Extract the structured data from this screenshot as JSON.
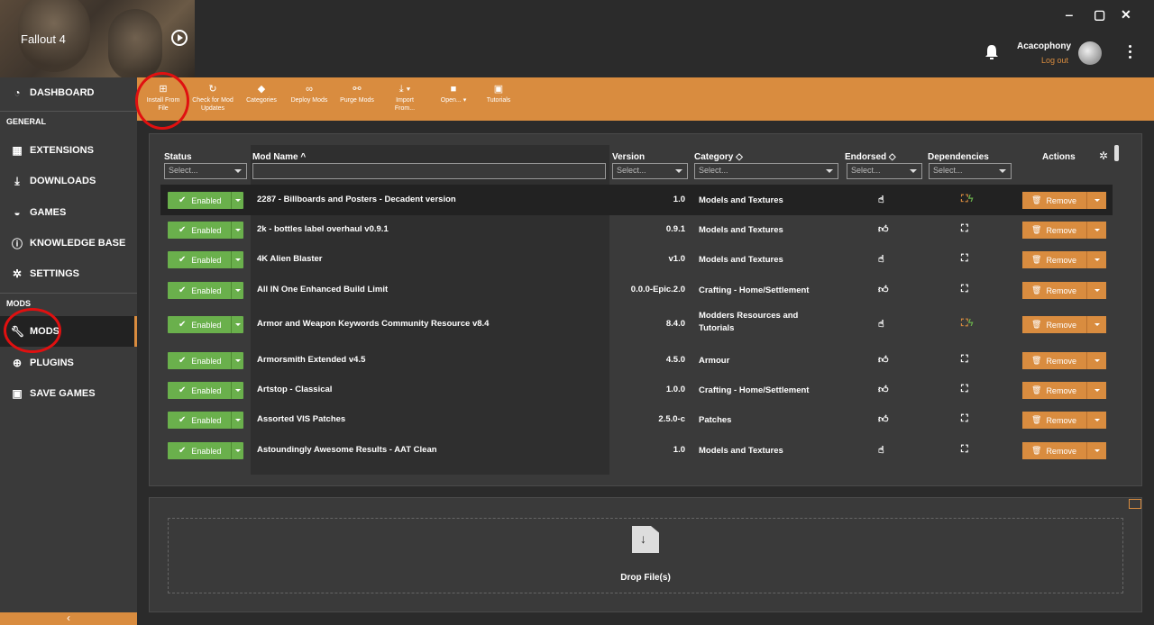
{
  "game": {
    "title": "Fallout 4"
  },
  "window": {
    "minimize": "‒",
    "maximize": "▢",
    "close": "✕"
  },
  "user": {
    "name": "Acacophony",
    "logout": "Log out"
  },
  "sidebar": {
    "dashboard": "DASHBOARD",
    "section_general": "GENERAL",
    "extensions": "EXTENSIONS",
    "downloads": "DOWNLOADS",
    "games": "GAMES",
    "knowledge_base": "KNOWLEDGE BASE",
    "settings": "SETTINGS",
    "section_mods": "MODS",
    "mods": "MODS",
    "plugins": "PLUGINS",
    "save_games": "SAVE GAMES"
  },
  "toolbar": {
    "install": "Install From File",
    "check": "Check for Mod Updates",
    "categories": "Categories",
    "deploy": "Deploy Mods",
    "purge": "Purge Mods",
    "import": "Import From...",
    "open": "Open...",
    "tutorials": "Tutorials"
  },
  "table": {
    "headers": {
      "status": "Status",
      "name": "Mod Name ^",
      "version": "Version",
      "category": "Category ◇",
      "endorsed": "Endorsed ◇",
      "dependencies": "Dependencies",
      "actions": "Actions"
    },
    "filter_placeholder": "Select...",
    "status_label": "Enabled",
    "remove_label": "Remove",
    "rows": [
      {
        "name": "2287 - Billboards and Posters - Decadent version",
        "version": "1.0",
        "category": "Models and Textures",
        "endorsed": false,
        "dep_active": true
      },
      {
        "name": "2k - bottles label overhaul v0.9.1",
        "version": "0.9.1",
        "category": "Models and Textures",
        "endorsed": true,
        "dep_active": false
      },
      {
        "name": "4K Alien Blaster",
        "version": "v1.0",
        "category": "Models and Textures",
        "endorsed": false,
        "dep_active": false
      },
      {
        "name": "All IN One Enhanced Build Limit",
        "version": "0.0.0-Epic.2.0",
        "category": "Crafting - Home/Settlement",
        "endorsed": true,
        "dep_active": false
      },
      {
        "name": "Armor and Weapon Keywords Community Resource v8.4",
        "version": "8.4.0",
        "category": "Modders Resources and Tutorials",
        "endorsed": false,
        "dep_active": true
      },
      {
        "name": "Armorsmith Extended v4.5",
        "version": "4.5.0",
        "category": "Armour",
        "endorsed": true,
        "dep_active": false
      },
      {
        "name": "Artstop - Classical",
        "version": "1.0.0",
        "category": "Crafting - Home/Settlement",
        "endorsed": true,
        "dep_active": false
      },
      {
        "name": "Assorted VIS Patches",
        "version": "2.5.0-c",
        "category": "Patches",
        "endorsed": true,
        "dep_active": false
      },
      {
        "name": "Astoundingly Awesome Results - AAT Clean",
        "version": "1.0",
        "category": "Models and Textures",
        "endorsed": false,
        "dep_active": false
      }
    ]
  },
  "dropzone": {
    "label": "Drop File(s)"
  },
  "colors": {
    "accent": "#d98c3f",
    "enabled": "#6ab04c",
    "annotation": "#e01010"
  }
}
